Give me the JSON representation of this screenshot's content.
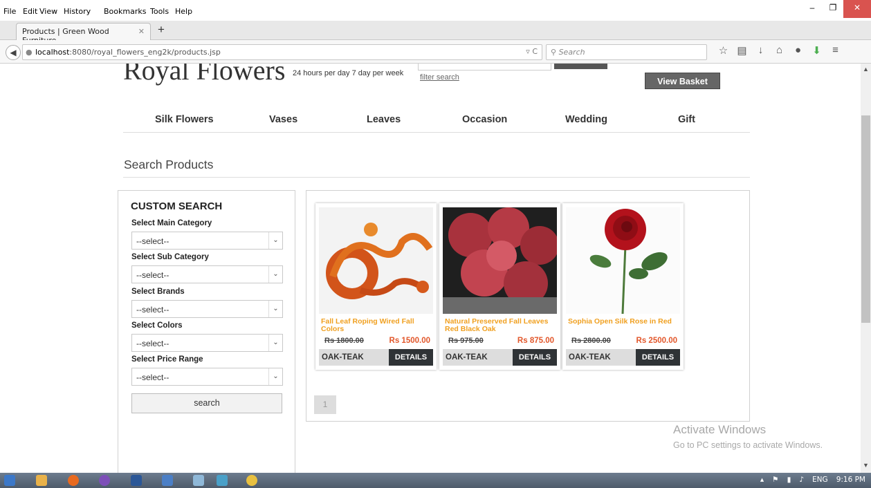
{
  "browser": {
    "menu": [
      "File",
      "Edit",
      "View",
      "History",
      "Bookmarks",
      "Tools",
      "Help"
    ],
    "tab_title": "Products | Green Wood Furniture",
    "url_host": "localhost",
    "url_rest": ":8080/royal_flowers_eng2k/products.jsp",
    "search_placeholder": "Search"
  },
  "header": {
    "logo": "Royal Flowers",
    "hours": "24 hours per day 7 day per week",
    "filter_link": "filter search",
    "view_basket": "View Basket"
  },
  "nav": [
    "Silk Flowers",
    "Vases",
    "Leaves",
    "Occasion",
    "Wedding",
    "Gift"
  ],
  "page_title": "Search Products",
  "custom_search": {
    "title": "CUSTOM SEARCH",
    "fields": [
      {
        "label": "Select Main Category",
        "value": "--select--"
      },
      {
        "label": "Select Sub Category",
        "value": "--select--"
      },
      {
        "label": "Select Brands",
        "value": "--select--"
      },
      {
        "label": "Select Colors",
        "value": "--select--"
      },
      {
        "label": "Select Price Range",
        "value": "--select--"
      }
    ],
    "search_button": "search"
  },
  "products": [
    {
      "name": "Fall Leaf Roping Wired Fall Colors",
      "old_price": "Rs 1800.00",
      "price": "Rs 1500.00",
      "brand": "OAK-TEAK",
      "details": "DETAILS"
    },
    {
      "name": "Natural Preserved Fall Leaves Red Black Oak",
      "old_price": "Rs 975.00",
      "price": "Rs 875.00",
      "brand": "OAK-TEAK",
      "details": "DETAILS"
    },
    {
      "name": "Sophia Open Silk Rose in Red",
      "old_price": "Rs 2800.00",
      "price": "Rs 2500.00",
      "brand": "OAK-TEAK",
      "details": "DETAILS"
    }
  ],
  "pagination": [
    "1"
  ],
  "watermark": {
    "line1": "Activate Windows",
    "line2": "Go to PC settings to activate Windows."
  },
  "taskbar": {
    "lang": "ENG",
    "time": "9:16 PM"
  }
}
